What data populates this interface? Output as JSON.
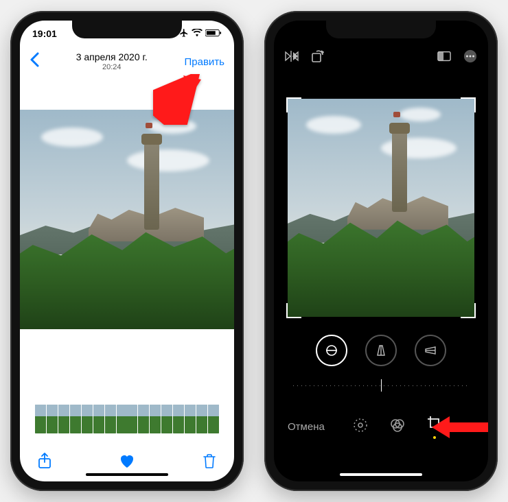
{
  "left": {
    "statusbar": {
      "time": "19:01"
    },
    "nav": {
      "date": "3 апреля 2020 г.",
      "time": "20:24",
      "edit": "Править"
    }
  },
  "right": {
    "bottom": {
      "cancel": "Отмена"
    },
    "icons": {
      "flip": "flip-horizontal-icon",
      "rotate": "rotate-icon",
      "aspect": "aspect-ratio-icon",
      "more": "more-icon",
      "straighten": "straighten-icon",
      "vertical": "vertical-perspective-icon",
      "horizontal": "horizontal-perspective-icon",
      "adjust": "adjust-icon",
      "filters": "filters-icon",
      "crop": "crop-icon"
    }
  }
}
